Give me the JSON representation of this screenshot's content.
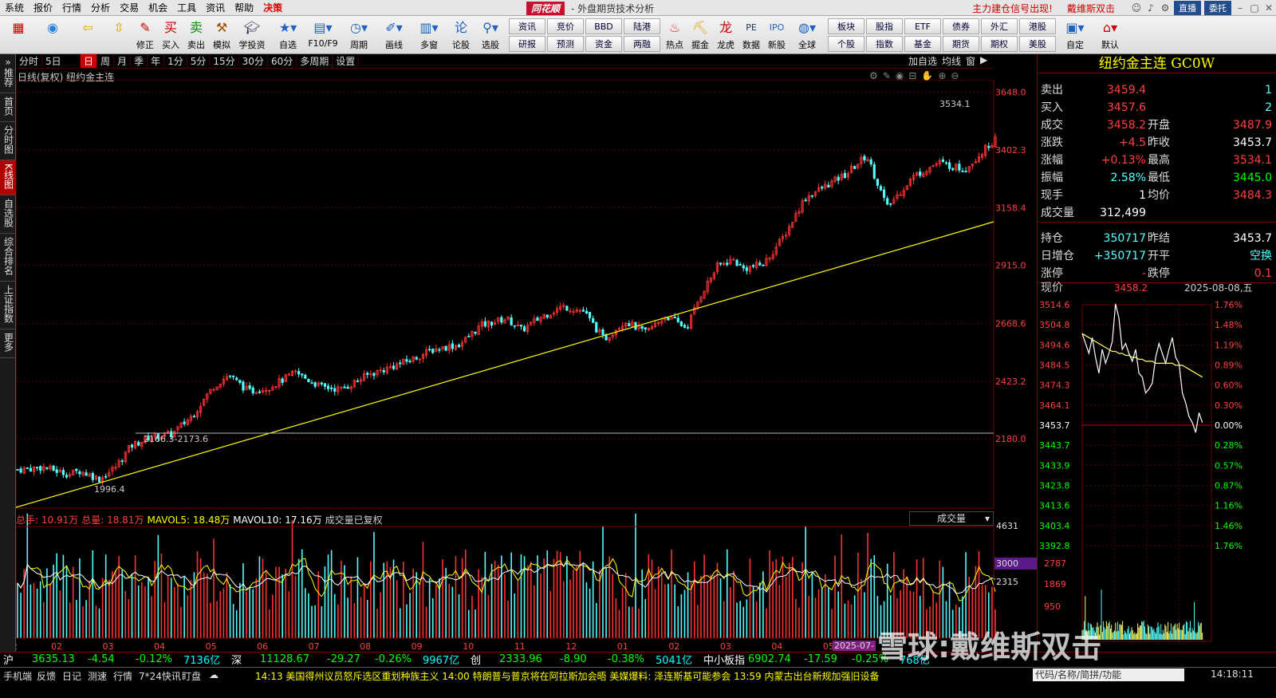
{
  "menu": {
    "items": [
      "系统",
      "报价",
      "行情",
      "分析",
      "交易",
      "机会",
      "工具",
      "资讯",
      "帮助",
      "决策"
    ],
    "app_logo": "同花顺",
    "app_title": "- 外盘期货技术分析"
  },
  "rightmenu": {
    "news1": "主力建仓信号出现!",
    "news2": "戴维斯双击",
    "live": "直播",
    "entrust": "委托"
  },
  "toolbar": {
    "big": [
      "修正",
      "买入",
      "卖出",
      "模拟",
      "学投资",
      "自选",
      "F10/F9",
      "周期",
      "画线",
      "多窗",
      "论股",
      "选股",
      "热点",
      "掘金",
      "龙虎",
      "数据",
      "新股",
      "全球",
      "自定",
      "默认"
    ],
    "small_top": [
      "资讯",
      "竞价",
      "BBD",
      "陆港",
      "板块",
      "股指",
      "ETF",
      "债券",
      "外汇",
      "港股"
    ],
    "small_bot": [
      "研报",
      "预测",
      "资金",
      "两融",
      "个股",
      "指数",
      "基金",
      "期货",
      "期权",
      "美股"
    ]
  },
  "lefttabs": [
    "推荐",
    "首页",
    "分时图",
    "K线图",
    "自选股",
    "综合排名",
    "上证指数",
    "更多"
  ],
  "periods": [
    "分时",
    "5日",
    "日",
    "周",
    "月",
    "季",
    "年",
    "1分",
    "5分",
    "15分",
    "30分",
    "60分",
    "多周期",
    "设置"
  ],
  "period_selected": "日",
  "topright": [
    "加自选",
    "均线",
    "窗",
    "▶"
  ],
  "ktitle": "日线(复权)  纽约金主连",
  "chart_data": {
    "type": "candlestick",
    "name": "纽约金主连",
    "y_axis": [
      3648.0,
      3402.3,
      3158.4,
      2915.0,
      2668.6,
      2423.2,
      2180.0
    ],
    "x_labels": [
      "12",
      "02",
      "03",
      "04",
      "05",
      "06",
      "07",
      "08",
      "09",
      "10",
      "11",
      "12",
      "01",
      "02",
      "03",
      "04",
      "05"
    ],
    "annotations": {
      "high": "3534.1",
      "low": "1996.4",
      "gap": "2166.3-2173.6"
    },
    "trendline_color": "#ffff00",
    "ylim": [
      1890,
      3700
    ],
    "path_months": [
      0,
      0.5,
      1,
      1.2,
      1.6,
      1.9,
      2.2,
      2.6,
      3,
      3.4,
      3.8,
      4.1,
      4.5,
      4.9,
      5.4,
      5.9,
      6.3,
      6.8,
      7.2,
      7.7,
      8.1,
      8.6,
      9,
      9.5,
      9.8,
      10.2,
      10.6,
      11,
      11.4,
      11.8,
      12.2,
      12.6,
      13,
      13.3,
      13.6,
      13.9,
      14.1,
      14.5,
      14.9,
      15.3,
      15.7,
      16.1,
      16.5,
      16.9,
      17.4,
      17.9,
      18.4,
      19
    ],
    "path_prices": [
      2050,
      2060,
      2030,
      2045,
      2010,
      2060,
      2150,
      2190,
      2200,
      2280,
      2400,
      2450,
      2380,
      2400,
      2460,
      2400,
      2390,
      2450,
      2480,
      2520,
      2560,
      2580,
      2660,
      2690,
      2640,
      2700,
      2740,
      2720,
      2600,
      2680,
      2630,
      2700,
      2650,
      2800,
      2910,
      2940,
      2900,
      2920,
      3040,
      3200,
      3250,
      3300,
      3380,
      3160,
      3290,
      3350,
      3320,
      3450
    ],
    "volume_axis": [
      "4631",
      "3000",
      "2315"
    ],
    "volume_highlight": "3000"
  },
  "vol_legend": [
    {
      "t": "总手: 10.91万",
      "c": "#ff4040"
    },
    {
      "t": "总量: 18.81万",
      "c": "#ff4040"
    },
    {
      "t": "MAVOL5: 18.48万",
      "c": "#ffff00"
    },
    {
      "t": "MAVOL10: 17.16万",
      "c": "#ffffff"
    },
    {
      "t": "成交量已复权",
      "c": "#ccc"
    }
  ],
  "vol_select": "成交量",
  "quote": {
    "title": "纽约金主连 GC0W",
    "rows": [
      [
        "卖出",
        "3459.4",
        "",
        "1"
      ],
      [
        "买入",
        "3457.6",
        "",
        "2"
      ],
      [
        "成交",
        "3458.2",
        "开盘",
        "3487.9"
      ],
      [
        "涨跌",
        "+4.5",
        "昨收",
        "3453.7"
      ],
      [
        "涨幅",
        "+0.13%",
        "最高",
        "3534.1"
      ],
      [
        "振幅",
        "2.58%",
        "最低",
        "3445.0"
      ],
      [
        "现手",
        "1",
        "均价",
        "3484.3"
      ],
      [
        "成交量",
        "312,499",
        "",
        ""
      ],
      [
        "持仓",
        "350717",
        "昨结",
        "3453.7"
      ],
      [
        "日增仓",
        "+350717",
        "开平",
        "空换"
      ],
      [
        "涨停",
        "-",
        "跌停",
        "0.1"
      ]
    ],
    "nowprice_label": "现价",
    "nowprice": "3458.2",
    "date": "2025-08-08,五"
  },
  "minute_chart": {
    "left_axis": [
      "3514.6",
      "3504.8",
      "3494.6",
      "3484.5",
      "3474.3",
      "3464.1",
      "3453.7",
      "3443.7",
      "3433.9",
      "3423.8",
      "3413.6",
      "3403.4",
      "3392.8"
    ],
    "right_axis": [
      "1.76%",
      "1.48%",
      "1.19%",
      "0.89%",
      "0.60%",
      "0.30%",
      "0.00%",
      "0.28%",
      "0.57%",
      "0.87%",
      "1.16%",
      "1.46%",
      "1.76%"
    ],
    "vol_axis": [
      "2787",
      "1869",
      "950"
    ],
    "prices": [
      3500,
      3495,
      3490,
      3498,
      3488,
      3480,
      3492,
      3485,
      3490,
      3496,
      3515,
      3508,
      3492,
      3495,
      3490,
      3486,
      3492,
      3480,
      3478,
      3470,
      3472,
      3475,
      3488,
      3495,
      3490,
      3485,
      3492,
      3498,
      3488,
      3485,
      3470,
      3465,
      3458,
      3455,
      3450,
      3460,
      3455
    ],
    "avg": [
      3500,
      3499,
      3498,
      3497,
      3496,
      3495,
      3494,
      3493,
      3492,
      3491,
      3491,
      3490,
      3490,
      3489,
      3489,
      3488,
      3488,
      3487,
      3487,
      3486,
      3486,
      3486,
      3485,
      3485,
      3485,
      3485,
      3485,
      3485,
      3484,
      3484,
      3484,
      3483,
      3482,
      3481,
      3480,
      3479,
      3478
    ]
  },
  "status": [
    {
      "t": "沪",
      "c": "#fff"
    },
    {
      "t": "3635.13",
      "c": "#00ff00"
    },
    {
      "t": "-4.54",
      "c": "#00ff00"
    },
    {
      "t": "-0.12%",
      "c": "#00ff00"
    },
    {
      "t": "7136亿",
      "c": "#00ffff"
    },
    {
      "t": "深",
      "c": "#fff"
    },
    {
      "t": "11128.67",
      "c": "#00ff00"
    },
    {
      "t": "-29.27",
      "c": "#00ff00"
    },
    {
      "t": "-0.26%",
      "c": "#00ff00"
    },
    {
      "t": "9967亿",
      "c": "#00ffff"
    },
    {
      "t": "创",
      "c": "#fff"
    },
    {
      "t": "2333.96",
      "c": "#00ff00"
    },
    {
      "t": "-8.90",
      "c": "#00ff00"
    },
    {
      "t": "-0.38%",
      "c": "#00ff00"
    },
    {
      "t": "5041亿",
      "c": "#00ffff"
    },
    {
      "t": "中小板指",
      "c": "#fff"
    },
    {
      "t": "6902.74",
      "c": "#00ff00"
    },
    {
      "t": "-17.59",
      "c": "#00ff00"
    },
    {
      "t": "-0.25%",
      "c": "#00ff00"
    },
    {
      "t": "768亿",
      "c": "#00ffff"
    }
  ],
  "bottom": {
    "tabs": [
      "手机端",
      "反馈",
      "日记",
      "测速",
      "行情",
      "7*24快讯",
      "盯盘"
    ],
    "news": "14:13 美国得州议员怒斥选区重划种族主义      14:00 特朗普与普京将在阿拉斯加会晤 美媒爆料: 泽连斯基可能参会      13:59 内蒙古出台新规加强旧设备",
    "code_placeholder": "代码/名称/简拼/功能",
    "clock": "14:18:11",
    "watermark": "雪球:戴维斯双击",
    "date_tag": "2025-07-"
  }
}
